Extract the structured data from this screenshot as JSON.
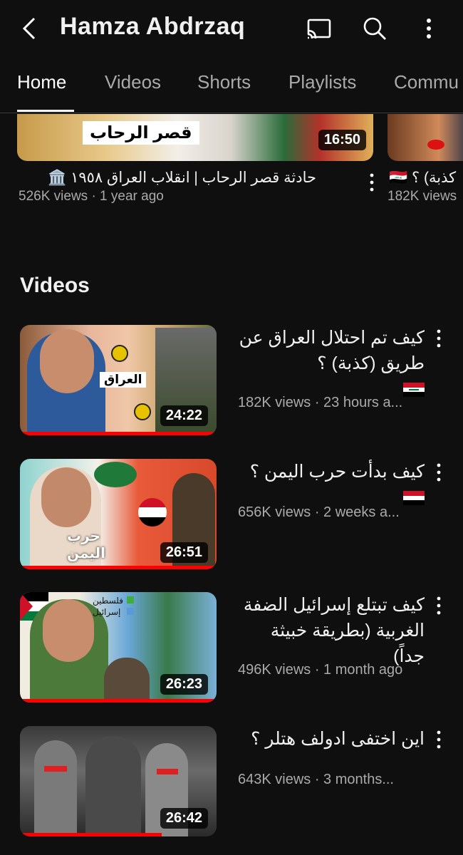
{
  "header": {
    "title": "Hamza Abdrzaq",
    "icons": [
      "back-arrow-icon",
      "cast-icon",
      "search-icon",
      "more-vert-icon"
    ]
  },
  "tabs": [
    {
      "label": "Home",
      "active": true
    },
    {
      "label": "Videos",
      "active": false
    },
    {
      "label": "Shorts",
      "active": false
    },
    {
      "label": "Playlists",
      "active": false
    },
    {
      "label": "Commu",
      "active": false
    }
  ],
  "top_cards": [
    {
      "thumb_text": "قصر الرحاب",
      "duration": "16:50",
      "title": "حادثة قصر الرحاب | انقلاب العراق ١٩٥٨ 🏛️",
      "meta": "526K views · 1 year ago"
    },
    {
      "title": "كذبة) ؟ 🇮🇶",
      "meta": "182K views"
    }
  ],
  "section": {
    "title": "Videos"
  },
  "videos": [
    {
      "title": "كيف تم احتلال العراق عن طريق (كذبة) ؟",
      "flag": "iraq",
      "duration": "24:22",
      "meta": "182K views · 23 hours a...",
      "thumb_label": "العراق",
      "progress": 1.0
    },
    {
      "title": "كيف بدأت حرب اليمن ؟",
      "flag": "yemen",
      "duration": "26:51",
      "meta": "656K views · 2 weeks a...",
      "thumb_label_1": "حرب",
      "thumb_label_2": "اليمن",
      "progress": 1.0
    },
    {
      "title": "كيف تبتلع إسرائيل الضفة الغربية (بطريقة خبيثة جداً)",
      "duration": "26:23",
      "meta": "496K views · 1 month ago",
      "legend_1": "فلسطين",
      "legend_2": "إسرائيل",
      "progress": 1.0
    },
    {
      "title": "اين اختفى ادولف هتلر ؟",
      "duration": "26:42",
      "meta": "643K views · 3 months...",
      "progress": 0.72
    }
  ],
  "colors": {
    "background": "#0f0f0f",
    "progress": "#ff0000",
    "meta": "#aaaaaa"
  }
}
